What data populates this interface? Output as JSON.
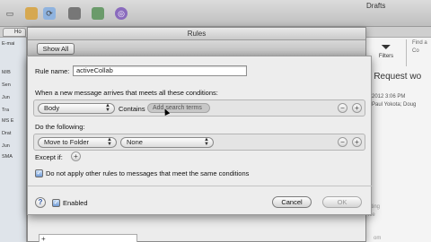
{
  "app": {
    "drafts_label": "Drafts",
    "tab_label": "Ho",
    "sidebar": [
      "E-mai",
      "M/B",
      "Sen",
      "Jun",
      "Tra",
      "MS E",
      "Drat",
      "Jun",
      "SMA"
    ],
    "filters_label": "Filters",
    "find_label": "Find a",
    "find_hint": "Co",
    "subject": "n Request wo",
    "date": "2012 3:06 PM",
    "from": "Paul Yokota; Doug",
    "snip1": "eting",
    "snip2": "ice",
    "snip3": "om"
  },
  "rules_window": {
    "title": "Rules",
    "show_all_label": "Show All"
  },
  "sheet": {
    "rule_name_label": "Rule name:",
    "rule_name_value": "activeCollab",
    "conditions_label": "When a new message arrives that meets all these conditions:",
    "condition": {
      "field": "Body",
      "operator": "Contains",
      "placeholder": "Add search terms"
    },
    "actions_label": "Do the following:",
    "action": {
      "type": "Move to Folder",
      "target": "None"
    },
    "except_label": "Except if:",
    "dont_apply_label": "Do not apply other rules to messages that meet the same conditions",
    "enabled_label": "Enabled",
    "cancel_label": "Cancel",
    "ok_label": "OK",
    "help_symbol": "?",
    "plus_symbol": "+",
    "minus_symbol": "−"
  }
}
